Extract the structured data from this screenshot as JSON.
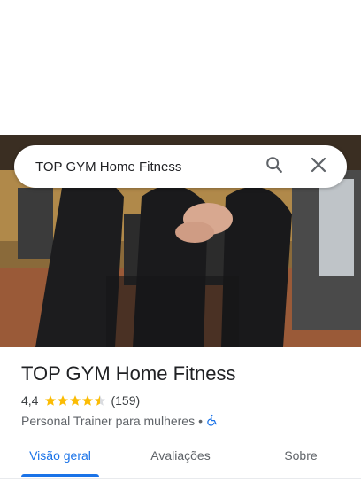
{
  "search": {
    "query": "TOP GYM Home Fitness"
  },
  "place": {
    "name": "TOP GYM Home Fitness",
    "rating": "4,4",
    "rating_value": 4.4,
    "review_count": "(159)",
    "category": "Personal Trainer para mulheres",
    "separator": "•",
    "accessibility_icon": "wheelchair-icon"
  },
  "tabs": [
    {
      "label": "Visão geral",
      "active": true
    },
    {
      "label": "Avaliações",
      "active": false
    },
    {
      "label": "Sobre",
      "active": false
    }
  ],
  "colors": {
    "accent": "#1a73e8",
    "star": "#fbbc04",
    "text": "#202124",
    "muted": "#5f6368"
  }
}
